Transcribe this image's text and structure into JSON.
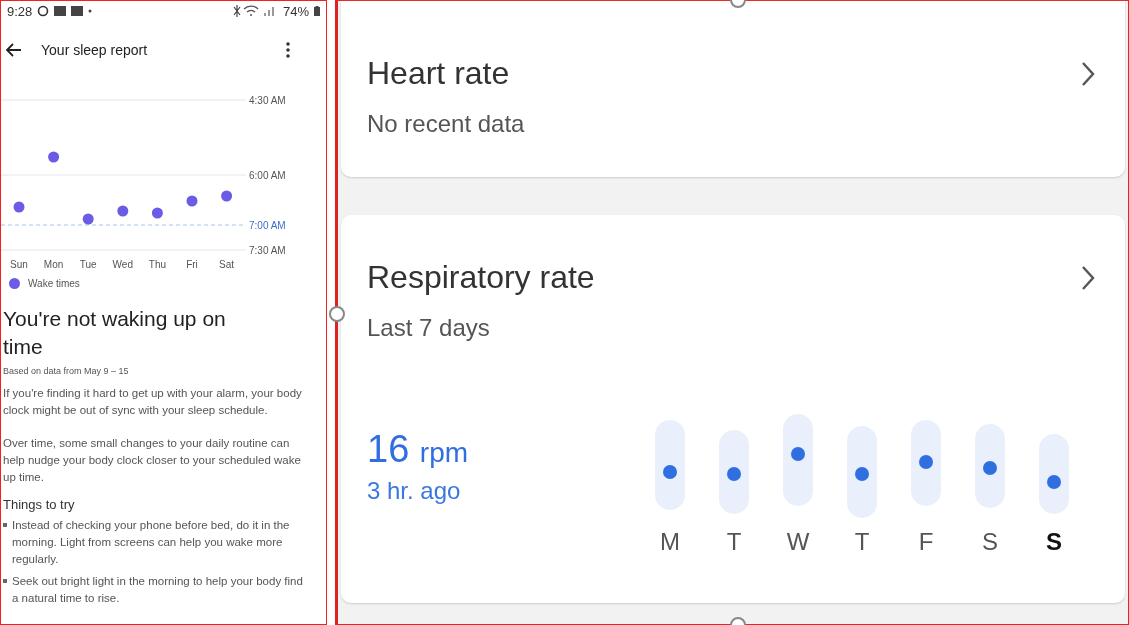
{
  "status_bar": {
    "time": "9:28",
    "battery": "74%"
  },
  "header": {
    "title": "Your sleep report"
  },
  "wake_chart": {
    "chart_data": {
      "type": "scatter",
      "categories": [
        "Sun",
        "Mon",
        "Tue",
        "Wed",
        "Thu",
        "Fri",
        "Sat"
      ],
      "series": [
        {
          "name": "Wake times",
          "color": "#6b5be6",
          "values": [
            6.64,
            5.64,
            6.88,
            6.72,
            6.76,
            6.52,
            6.42
          ]
        }
      ],
      "ylim": [
        7.5,
        4.5
      ],
      "yticks": [
        {
          "value": 4.5,
          "label": "4:30 AM"
        },
        {
          "value": 6,
          "label": "6:00 AM"
        },
        {
          "value": 7.5,
          "label": "7:30 AM"
        }
      ],
      "ref_lines": [
        {
          "axis": "y",
          "value": 7,
          "label": "7:00 AM"
        }
      ]
    }
  },
  "insight": {
    "title": "You're not waking up on time",
    "subtitle": "Based on data from May 9 – 15",
    "paragraphs": [
      "If you're finding it hard to get up with your alarm, your body clock might be out of sync with your sleep schedule.",
      "Over time, some small changes to your daily routine can help nudge your body clock closer to your scheduled wake up time."
    ],
    "tips_title": "Things to try",
    "tips": [
      "Instead of checking your phone before bed, do it in the morning. Light from screens can help you wake more regularly.",
      "Seek out bright light in the morning to help your body find a natural time to rise."
    ]
  },
  "cards": [
    {
      "title": "Heart rate",
      "subtitle": "No recent data"
    },
    {
      "title": "Respiratory rate",
      "subtitle": "Last 7 days",
      "value": "16",
      "unit": "rpm",
      "time": "3 hr. ago",
      "days": [
        {
          "label": "M",
          "selected": false
        },
        {
          "label": "T",
          "selected": false
        },
        {
          "label": "W",
          "selected": false
        },
        {
          "label": "T",
          "selected": false
        },
        {
          "label": "F",
          "selected": false
        },
        {
          "label": "S",
          "selected": false
        },
        {
          "label": "S",
          "selected": true
        }
      ]
    }
  ]
}
